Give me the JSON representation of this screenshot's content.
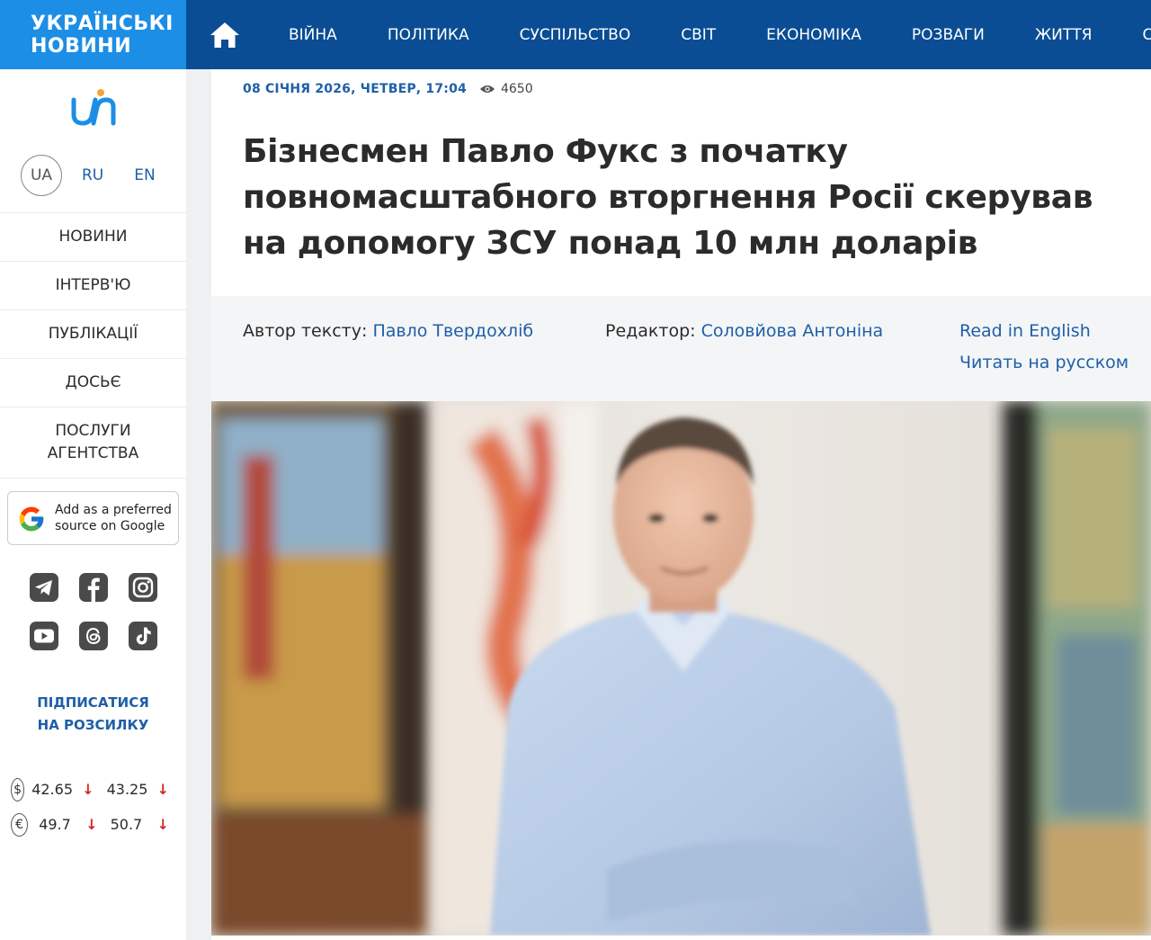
{
  "header": {
    "logo_line1": "УКРАЇНСЬКІ",
    "logo_line2": "НОВИНИ",
    "nav": [
      "ВІЙНА",
      "ПОЛІТИКА",
      "СУСПІЛЬСТВО",
      "СВІТ",
      "ЕКОНОМІКА",
      "РОЗВАГИ",
      "ЖИТТЯ",
      "СП"
    ],
    "home_icon": "home-icon"
  },
  "sidebar": {
    "languages": {
      "active": "UA",
      "ru": "RU",
      "en": "EN"
    },
    "menu": [
      "НОВИНИ",
      "ІНТЕРВ'Ю",
      "ПУБЛІКАЦІЇ",
      "ДОСЬЄ",
      "ПОСЛУГИ АГЕНТСТВА"
    ],
    "google_pref": {
      "line1": "Add as a preferred",
      "line2": "source on Google"
    },
    "socials": [
      "telegram-icon",
      "facebook-icon",
      "instagram-icon",
      "youtube-icon",
      "threads-icon",
      "tiktok-icon"
    ],
    "subscribe": "ПІДПИСАТИСЯ НА РОЗСИЛКУ",
    "rates": [
      {
        "currency": "$",
        "buy": "42.65",
        "sell": "43.25"
      },
      {
        "currency": "€",
        "buy": "49.7",
        "sell": "50.7"
      }
    ],
    "rate_arrow": "↓"
  },
  "article": {
    "date": "08 СІЧНЯ 2026, ЧЕТВЕР, 17:04",
    "views": "4650",
    "title": "Бізнесмен Павло Фукс з початку повномасштабного вторгнення Росії скерував на допомогу ЗСУ понад 10 млн доларів",
    "author_label": "Автор тексту:",
    "author": "Павло Твердохліб",
    "editor_label": "Редактор:",
    "editor": "Соловйова Антоніна",
    "read_en": "Read in English",
    "read_ru": "Читать на русском"
  },
  "colors": {
    "top_bar": "#0a4d94",
    "logo_bg": "#1c8ee6",
    "link": "#1f5fa8",
    "down_arrow": "#d8262c"
  }
}
